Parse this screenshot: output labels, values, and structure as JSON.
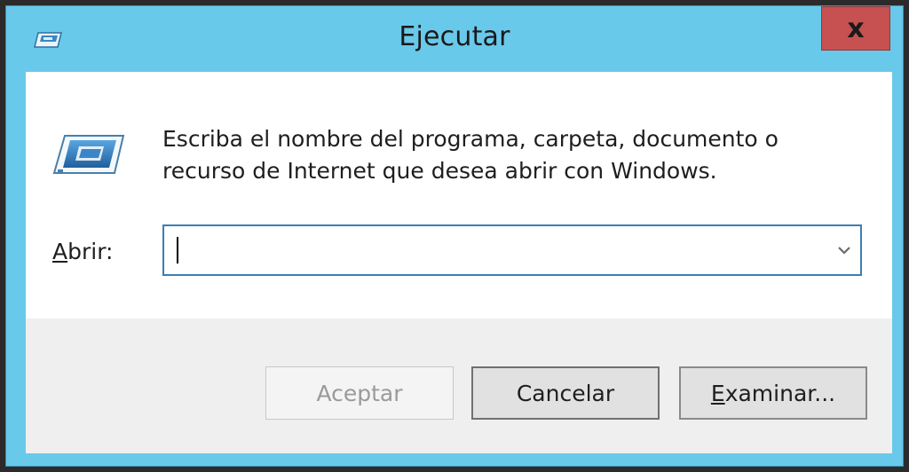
{
  "window": {
    "title": "Ejecutar",
    "close_glyph": "x",
    "title_icon": "run-dialog-icon"
  },
  "content": {
    "icon": "run-program-icon",
    "description_line1": "Escriba el nombre del programa, carpeta, documento o",
    "description_line2": "recurso de Internet que desea abrir con Windows.",
    "open_label_mnemonic": "A",
    "open_label_rest": "brir:",
    "open_input": {
      "value": "",
      "placeholder": ""
    },
    "dropdown_icon": "chevron-down-icon"
  },
  "buttons": {
    "accept_label": "Aceptar",
    "cancel_label": "Cancelar",
    "browse_mnemonic": "E",
    "browse_rest": "xaminar..."
  },
  "colors": {
    "title_bar": "#69c9ea",
    "close_button": "#c75050",
    "input_border": "#3c7fb1"
  }
}
